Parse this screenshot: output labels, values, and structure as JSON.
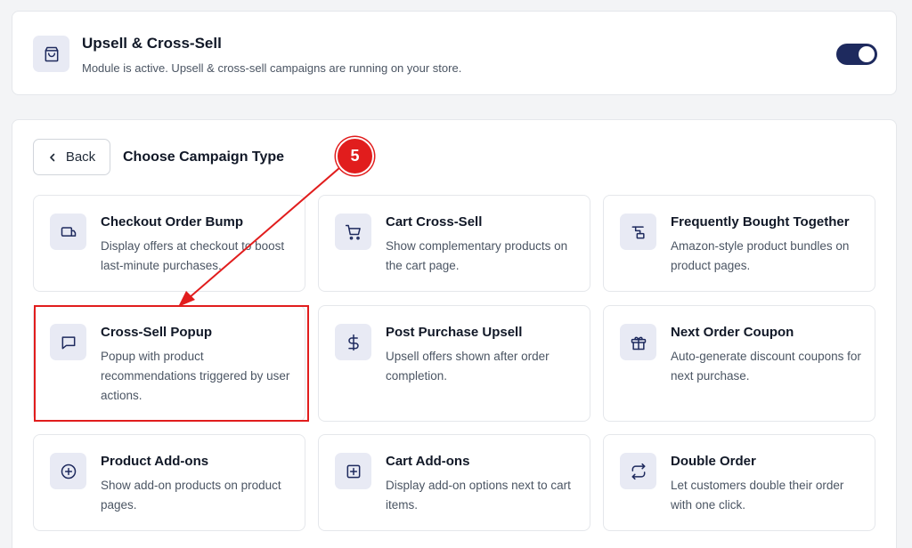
{
  "module": {
    "title": "Upsell & Cross-Sell",
    "description": "Module is active. Upsell & cross-sell campaigns are running on your store.",
    "active": true
  },
  "panel": {
    "back_label": "Back",
    "title": "Choose Campaign Type"
  },
  "campaigns": [
    {
      "title": "Checkout Order Bump",
      "description": "Display offers at checkout to boost last-minute purchases.",
      "icon": "order-bump-icon"
    },
    {
      "title": "Cart Cross-Sell",
      "description": "Show complementary products on the cart page.",
      "icon": "cart-icon"
    },
    {
      "title": "Frequently Bought Together",
      "description": "Amazon-style product bundles on product pages.",
      "icon": "bundle-icon"
    },
    {
      "title": "Cross-Sell Popup",
      "description": "Popup with product recommendations triggered by user actions.",
      "icon": "message-icon"
    },
    {
      "title": "Post Purchase Upsell",
      "description": "Upsell offers shown after order completion.",
      "icon": "dollar-icon"
    },
    {
      "title": "Next Order Coupon",
      "description": "Auto-generate discount coupons for next purchase.",
      "icon": "gift-icon"
    },
    {
      "title": "Product Add-ons",
      "description": "Show add-on products on product pages.",
      "icon": "plus-circle-icon"
    },
    {
      "title": "Cart Add-ons",
      "description": "Display add-on options next to cart items.",
      "icon": "plus-square-icon"
    },
    {
      "title": "Double Order",
      "description": "Let customers double their order with one click.",
      "icon": "repeat-icon"
    }
  ],
  "annotation": {
    "step": "5",
    "color": "#e11d1d"
  },
  "colors": {
    "accent": "#1e2a5e",
    "icon_bg": "#e8eaf4"
  }
}
